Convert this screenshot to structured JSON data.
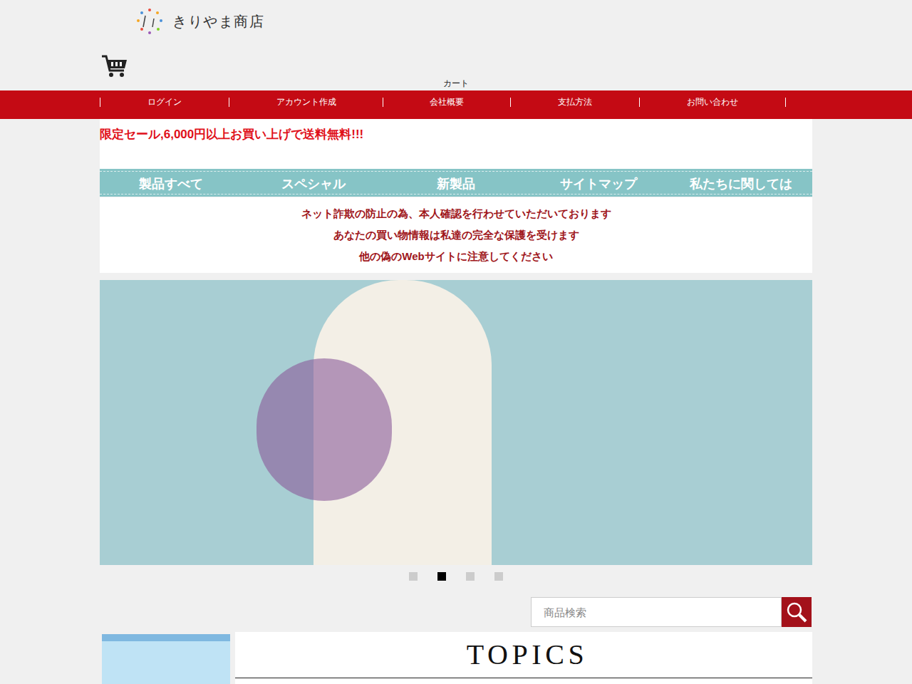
{
  "logo": {
    "name": "きりやま商店"
  },
  "cart": {
    "label": "カート"
  },
  "nav": [
    "ログイン",
    "アカウント作成",
    "会社概要",
    "支払方法",
    "お問い合わせ"
  ],
  "notice": "限定セール,6,000円以上お買い上げで送料無料!!!",
  "menu": [
    "製品すべて",
    "スペシャル",
    "新製品",
    "サイトマップ",
    "私たちに関しては"
  ],
  "security": [
    "ネット詐欺の防止の為、本人確認を行わせていただいております",
    "あなたの買い物情報は私達の完全な保護を受けます",
    "他の偽のWebサイトに注意してください"
  ],
  "carousel": {
    "dots": [
      {
        "selected": false
      },
      {
        "selected": true
      },
      {
        "selected": false
      },
      {
        "selected": false
      }
    ]
  },
  "search": {
    "placeholder": "商品検索"
  },
  "topics": {
    "title": "TOPICS"
  }
}
